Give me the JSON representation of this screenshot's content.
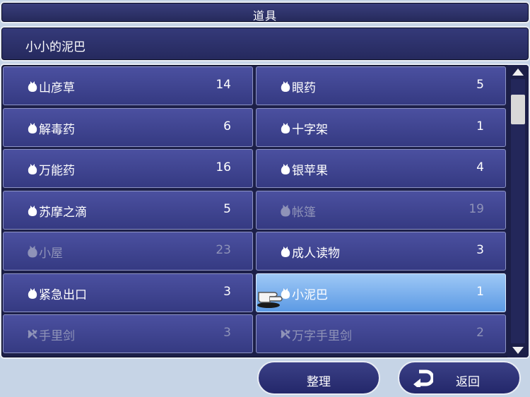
{
  "title": "道具",
  "description": "小小的泥巴",
  "items": [
    {
      "name": "山彦草",
      "qty": "14",
      "icon": "bag-icon",
      "disabled": false,
      "selected": false
    },
    {
      "name": "眼药",
      "qty": "5",
      "icon": "bag-icon",
      "disabled": false,
      "selected": false
    },
    {
      "name": "解毒药",
      "qty": "6",
      "icon": "bag-icon",
      "disabled": false,
      "selected": false
    },
    {
      "name": "十字架",
      "qty": "1",
      "icon": "bag-icon",
      "disabled": false,
      "selected": false
    },
    {
      "name": "万能药",
      "qty": "16",
      "icon": "bag-icon",
      "disabled": false,
      "selected": false
    },
    {
      "name": "银苹果",
      "qty": "4",
      "icon": "bag-icon",
      "disabled": false,
      "selected": false
    },
    {
      "name": "苏摩之滴",
      "qty": "5",
      "icon": "bag-icon",
      "disabled": false,
      "selected": false
    },
    {
      "name": "帐篷",
      "qty": "19",
      "icon": "bag-icon",
      "disabled": true,
      "selected": false
    },
    {
      "name": "小屋",
      "qty": "23",
      "icon": "bag-icon",
      "disabled": true,
      "selected": false
    },
    {
      "name": "成人读物",
      "qty": "3",
      "icon": "bag-icon",
      "disabled": false,
      "selected": false
    },
    {
      "name": "紧急出口",
      "qty": "3",
      "icon": "bag-icon",
      "disabled": false,
      "selected": false
    },
    {
      "name": "小泥巴",
      "qty": "1",
      "icon": "bag-icon",
      "disabled": false,
      "selected": true
    },
    {
      "name": "手里剑",
      "qty": "3",
      "icon": "shuriken-icon",
      "disabled": true,
      "selected": false
    },
    {
      "name": "万字手里剑",
      "qty": "2",
      "icon": "shuriken-icon",
      "disabled": true,
      "selected": false
    }
  ],
  "buttons": {
    "sort": "整理",
    "back": "返回"
  },
  "colors": {
    "panel": "#3a3f7e",
    "cell": "#4b50a0",
    "selected": "#7fb2ee",
    "disabled_text": "#8f93b8",
    "background": "#c6d4e6"
  }
}
